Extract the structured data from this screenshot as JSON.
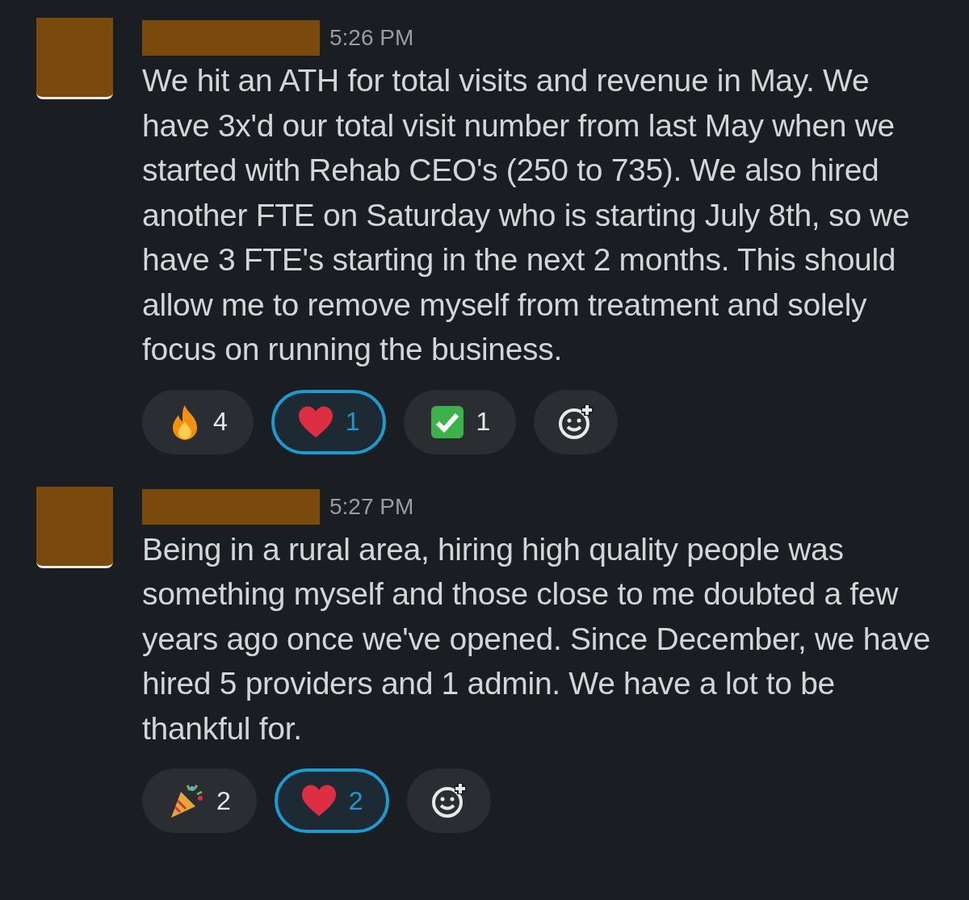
{
  "messages": [
    {
      "time": "5:26 PM",
      "text": "We hit an ATH for total visits and revenue in May.  We have 3x'd our total visit number from last May when we started with Rehab CEO's (250 to 735).  We also hired another FTE on Saturday who is starting July 8th, so we have 3 FTE's starting in the next 2 months.  This should allow me to remove myself from treatment and solely focus on running the business.",
      "reactions": [
        {
          "kind": "fire",
          "count": "4",
          "selected": false
        },
        {
          "kind": "heart",
          "count": "1",
          "selected": true
        },
        {
          "kind": "check",
          "count": "1",
          "selected": false
        }
      ]
    },
    {
      "time": "5:27 PM",
      "text": "Being in a rural area, hiring high quality people was something myself and those close to me doubted a few years ago once we've opened.  Since December, we have hired 5 providers and 1 admin.  We have a lot to be thankful for.",
      "reactions": [
        {
          "kind": "party",
          "count": "2",
          "selected": false
        },
        {
          "kind": "heart",
          "count": "2",
          "selected": true
        }
      ]
    }
  ]
}
